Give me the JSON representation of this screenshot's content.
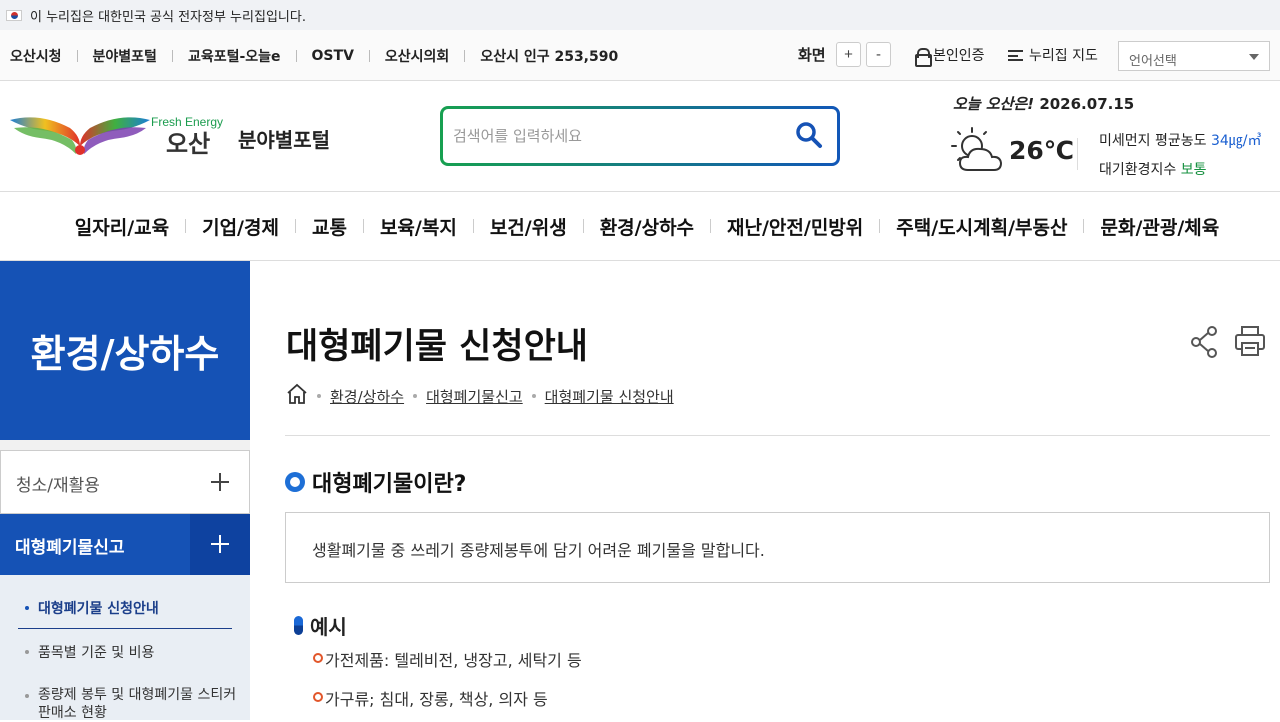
{
  "gov_banner": {
    "text": "이 누리집은 대한민국 공식 전자정부 누리집입니다."
  },
  "util": {
    "links": [
      "오산시청",
      "분야별포털",
      "교육포털-오늘e",
      "OSTV",
      "오산시의회",
      "오산시 인구 253,590"
    ],
    "zoom_label": "화면",
    "zoom_in": "+",
    "zoom_out": "-",
    "auth": "본인인증",
    "sitemap": "누리집 지도",
    "language": "언어선택"
  },
  "header": {
    "logo_tagline": "Fresh Energy",
    "logo_name": "오산",
    "portal_title": "분야별포털",
    "search_placeholder": "검색어를 입력하세요"
  },
  "weather": {
    "today_label": "오늘 오산은!",
    "date": "2026.07.15",
    "temp": "26℃",
    "dust_label": "미세먼지 평균농도",
    "dust_value": "34㎍/㎥",
    "air_label": "대기환경지수",
    "air_value": "보통"
  },
  "gnb": [
    "일자리/교육",
    "기업/경제",
    "교통",
    "보육/복지",
    "보건/위생",
    "환경/상하수",
    "재난/안전/민방위",
    "주택/도시계획/부동산",
    "문화/관광/체육"
  ],
  "sidebar": {
    "title": "환경/상하수",
    "menu": [
      "청소/재활용",
      "대형폐기물신고"
    ],
    "sub": [
      "대형폐기물 신청안내",
      "품목별 기준 및 비용",
      "종량제 봉투 및 대형폐기물 스티커 판매소 현황"
    ]
  },
  "content": {
    "title": "대형폐기물 신청안내",
    "breadcrumb": [
      "환경/상하수",
      "대형폐기물신고",
      "대형폐기물 신청안내"
    ],
    "section_title": "대형폐기물이란?",
    "section_desc": "생활폐기물 중 쓰레기 종량제봉투에 담기 어려운 폐기물을 말합니다.",
    "example_title": "예시",
    "examples": [
      "가전제품: 텔레비전, 냉장고, 세탁기 등",
      "가구류; 침대, 장롱, 책상, 의자 등"
    ]
  }
}
